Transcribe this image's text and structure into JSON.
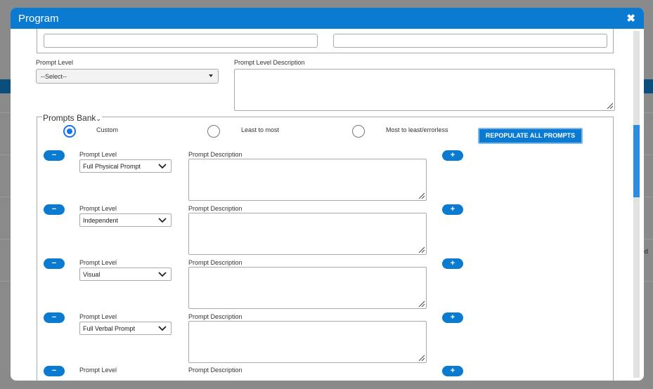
{
  "modal": {
    "title": "Program"
  },
  "background": {
    "partial_text": "ed"
  },
  "prompt_level": {
    "label": "Prompt Level",
    "selected": "--Select--"
  },
  "prompt_level_description": {
    "label": "Prompt Level Description"
  },
  "prompts_bank": {
    "legend": "Prompts Bank",
    "options": [
      "Custom",
      "Least to most",
      "Most to least/errorless"
    ],
    "selected": "Custom",
    "repopulate_label": "REPOPULATE ALL PROMPTS",
    "rows": [
      {
        "level_label": "Prompt Level",
        "level": "Full Physical Prompt",
        "desc_label": "Prompt Description"
      },
      {
        "level_label": "Prompt Level",
        "level": "Independent",
        "desc_label": "Prompt Description"
      },
      {
        "level_label": "Prompt Level",
        "level": "Visual",
        "desc_label": "Prompt Description"
      },
      {
        "level_label": "Prompt Level",
        "level": "Full Verbal Prompt",
        "desc_label": "Prompt Description"
      },
      {
        "level_label": "Prompt Level",
        "level": "",
        "desc_label": "Prompt Description"
      }
    ],
    "remove_symbol": "−",
    "add_symbol": "+"
  }
}
